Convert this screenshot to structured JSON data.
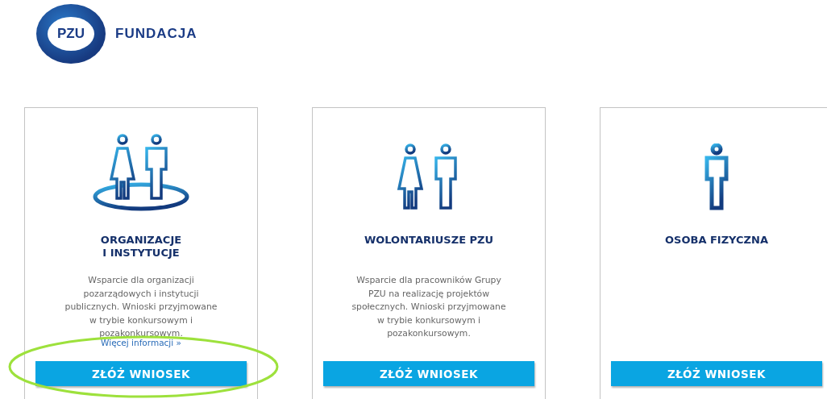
{
  "header": {
    "logo_text": "PZU",
    "title": "FUNDACJA"
  },
  "cards": [
    {
      "kind": "group",
      "title": "ORGANIZACJE\nI INSTYTUCJE",
      "description": "Wsparcie dla organizacji pozarządowych i instytucji publicznych. Wnioski przyjmowane w trybie konkursowym i pozakonkursowym.",
      "link": "Więcej informacji »",
      "button": "ZŁÓŻ WNIOSEK",
      "highlighted": true
    },
    {
      "kind": "pair",
      "title": "WOLONTARIUSZE PZU",
      "description": "Wsparcie dla pracowników Grupy PZU na realizację projektów społecznych. Wnioski przyjmowane w trybie konkursowym i pozakonkursowym.",
      "button": "ZŁÓŻ WNIOSEK",
      "highlighted": false
    },
    {
      "kind": "single",
      "title": "OSOBA FIZYCZNA",
      "button": "ZŁÓŻ WNIOSEK",
      "highlighted": false
    }
  ]
}
